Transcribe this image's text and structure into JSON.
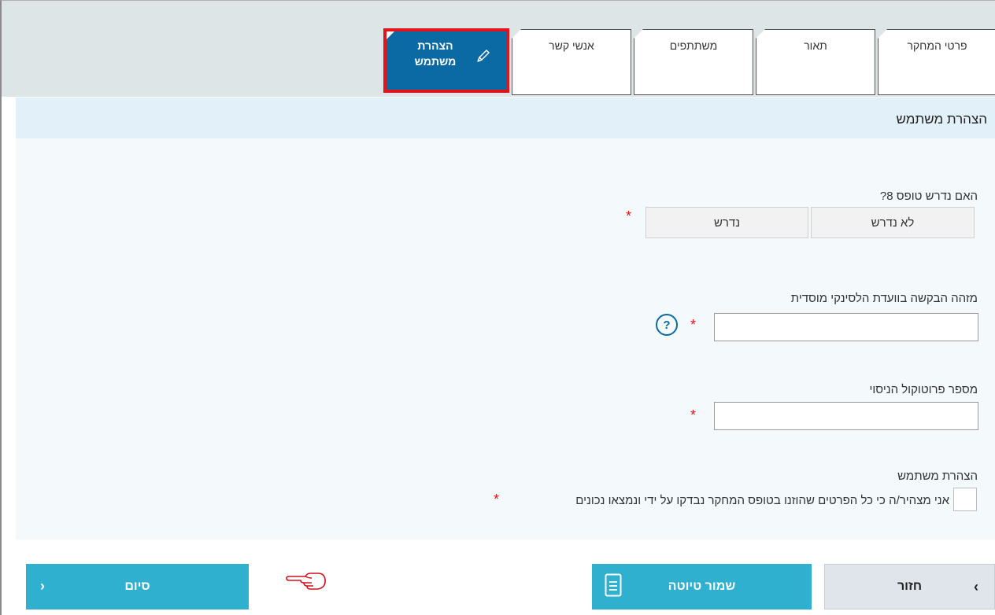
{
  "tabs": [
    {
      "label": "פרטי המחקר"
    },
    {
      "label": "תאור"
    },
    {
      "label": "משתתפים"
    },
    {
      "label": "אנשי קשר"
    }
  ],
  "active_tab": {
    "line1": "הצהרת",
    "line2": "משתמש",
    "icon": "pencil-icon"
  },
  "section": {
    "title": "הצהרת משתמש"
  },
  "form": {
    "q_form8": {
      "label": "האם נדרש טופס 8?",
      "options": [
        "לא נדרש",
        "נדרש"
      ]
    },
    "helsinki_id": {
      "label": "מזהה הבקשה בוועדת הלסינקי מוסדית",
      "value": "",
      "help": "?"
    },
    "protocol": {
      "label": "מספר פרוטוקול הניסוי",
      "value": ""
    },
    "declaration": {
      "label": "הצהרת משתמש",
      "text": "אני מצהיר/ה כי כל הפרטים שהוזנו בטופס המחקר נבדקו על ידי ונמצאו נכונים",
      "checked": false
    },
    "required_mark": "*"
  },
  "buttons": {
    "back": "חזור",
    "draft": "שמור טיוטה",
    "finish": "סיום",
    "back_chevron": "‹",
    "finish_chevron": "›"
  },
  "colors": {
    "accent": "#0b6aa3",
    "button": "#2fb0cf",
    "highlight": "#e2141b"
  }
}
